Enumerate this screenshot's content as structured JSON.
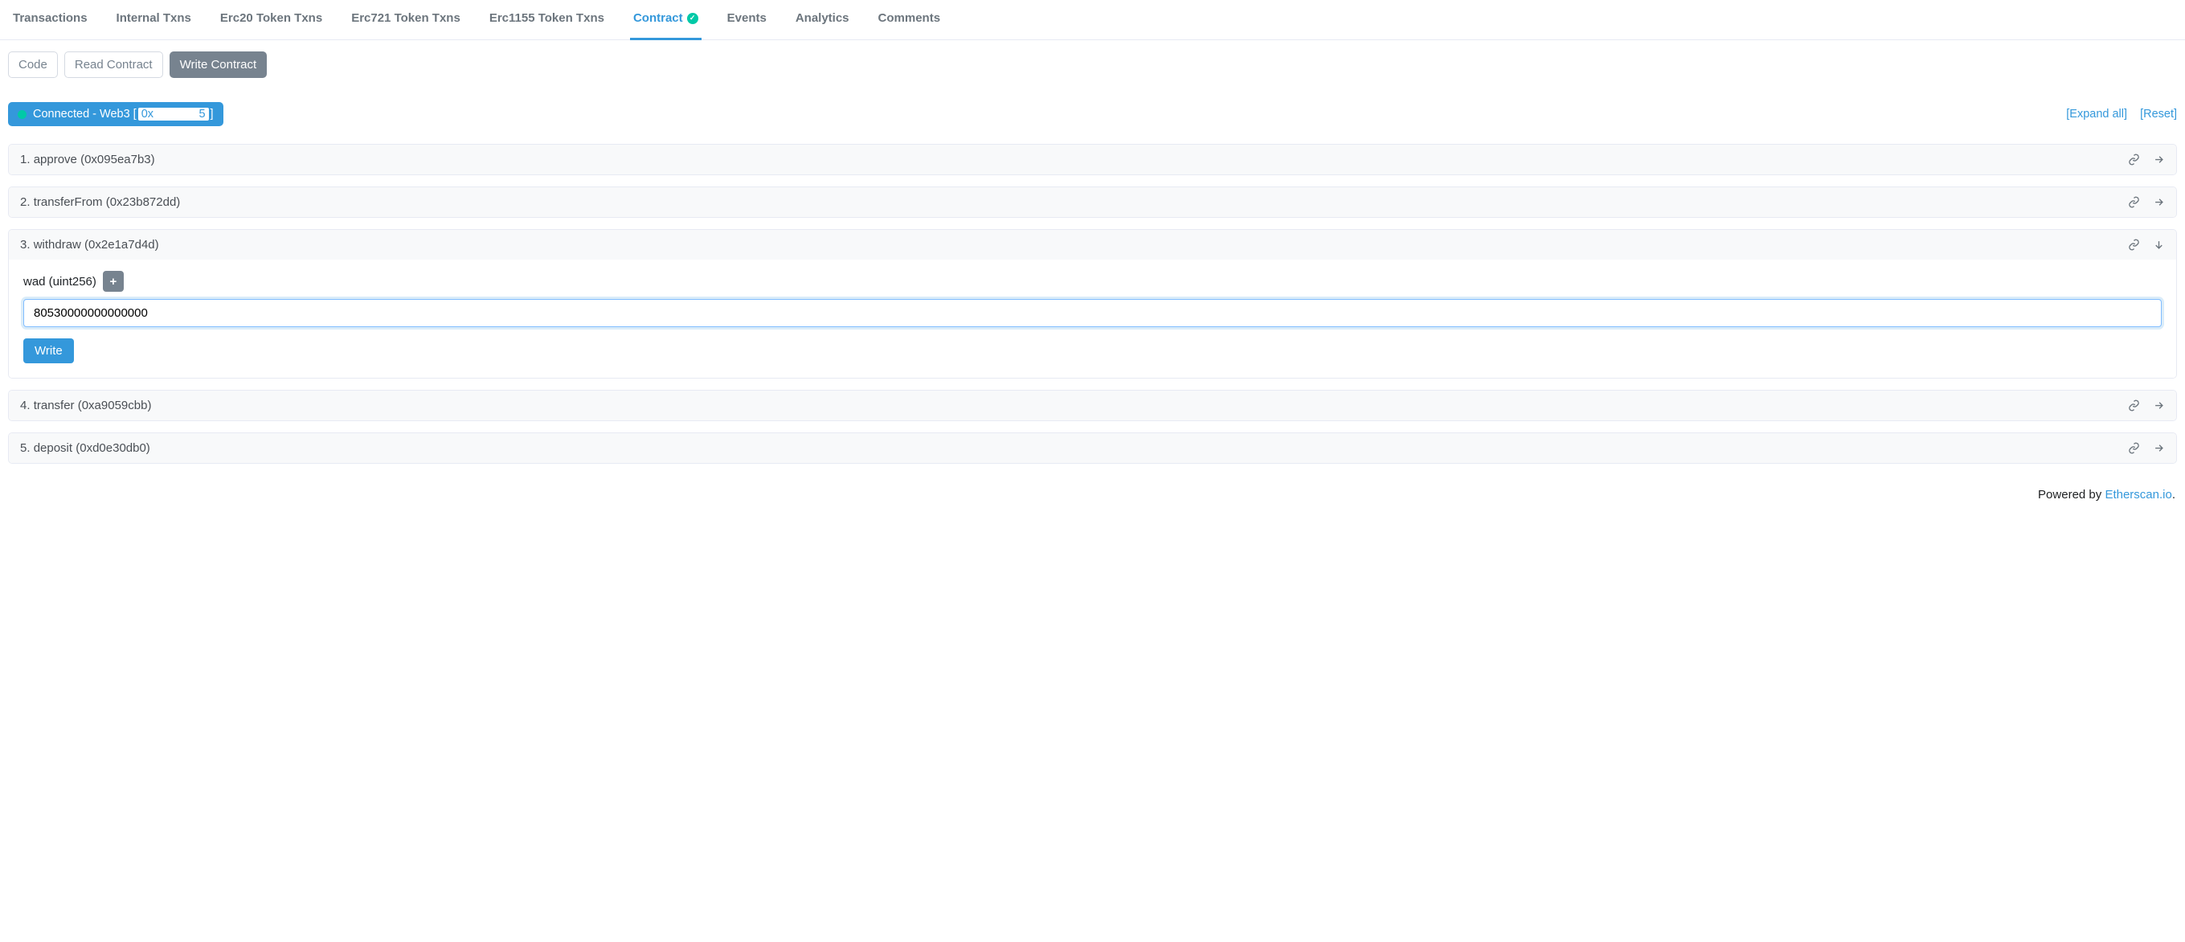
{
  "tabs": {
    "transactions": "Transactions",
    "internal": "Internal Txns",
    "erc20": "Erc20 Token Txns",
    "erc721": "Erc721 Token Txns",
    "erc1155": "Erc1155 Token Txns",
    "contract": "Contract",
    "events": "Events",
    "analytics": "Analytics",
    "comments": "Comments"
  },
  "subtabs": {
    "code": "Code",
    "read": "Read Contract",
    "write": "Write Contract"
  },
  "connection": {
    "status_text": "Connected - Web3",
    "addr_prefix": "0x",
    "addr_suffix": "5"
  },
  "actions": {
    "expand_all": "[Expand all]",
    "reset": "[Reset]"
  },
  "functions": [
    {
      "idx": "1.",
      "name": "approve",
      "sig": "(0x095ea7b3)",
      "expanded": false
    },
    {
      "idx": "2.",
      "name": "transferFrom",
      "sig": "(0x23b872dd)",
      "expanded": false
    },
    {
      "idx": "3.",
      "name": "withdraw",
      "sig": "(0x2e1a7d4d)",
      "expanded": true,
      "param_label": "wad (uint256)",
      "param_value": "80530000000000000",
      "write_label": "Write"
    },
    {
      "idx": "4.",
      "name": "transfer",
      "sig": "(0xa9059cbb)",
      "expanded": false
    },
    {
      "idx": "5.",
      "name": "deposit",
      "sig": "(0xd0e30db0)",
      "expanded": false
    }
  ],
  "footer": {
    "powered_by": "Powered by ",
    "site": "Etherscan.io",
    "dot": "."
  }
}
